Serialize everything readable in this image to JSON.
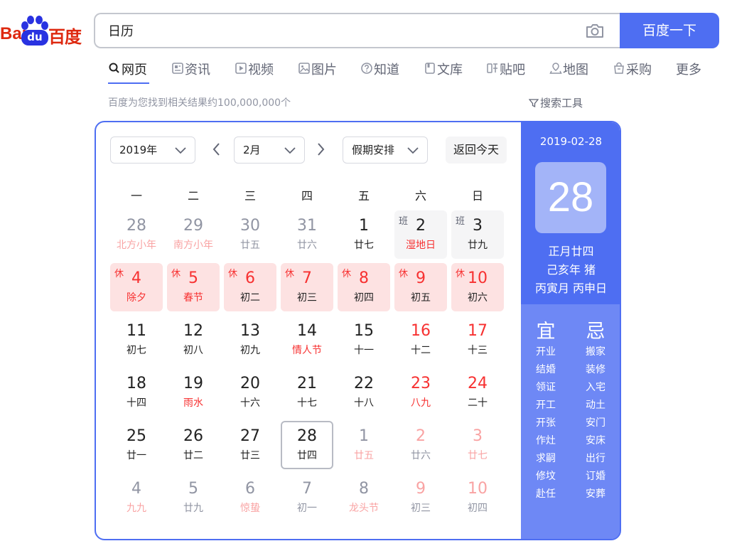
{
  "search": {
    "query": "日历",
    "button_label": "百度一下"
  },
  "logo": {
    "lead": "Bai",
    "du": "du",
    "cn": "百度"
  },
  "tabs": [
    {
      "label": "网页",
      "icon": "search-icon"
    },
    {
      "label": "资讯",
      "icon": "news-icon"
    },
    {
      "label": "视频",
      "icon": "video-icon"
    },
    {
      "label": "图片",
      "icon": "image-icon"
    },
    {
      "label": "知道",
      "icon": "question-icon"
    },
    {
      "label": "文库",
      "icon": "document-icon"
    },
    {
      "label": "贴吧",
      "icon": "tieba-icon"
    },
    {
      "label": "地图",
      "icon": "map-icon"
    },
    {
      "label": "采购",
      "icon": "shopping-icon"
    },
    {
      "label": "更多",
      "icon": ""
    }
  ],
  "results": {
    "count_text": "百度为您找到相关结果约100,000,000个",
    "tools_label": "搜索工具"
  },
  "calendar": {
    "year_select": "2019年",
    "month_select": "2月",
    "holiday_select": "假期安排",
    "today_button": "返回今天",
    "weekdays": [
      "一",
      "二",
      "三",
      "四",
      "五",
      "六",
      "日"
    ],
    "days": [
      {
        "n": "28",
        "s": "北方小年",
        "nc": "gray",
        "sc": "lred"
      },
      {
        "n": "29",
        "s": "南方小年",
        "nc": "gray",
        "sc": "lred"
      },
      {
        "n": "30",
        "s": "廿五",
        "nc": "gray",
        "sc": "gray"
      },
      {
        "n": "31",
        "s": "廿六",
        "nc": "gray",
        "sc": "gray"
      },
      {
        "n": "1",
        "s": "廿七",
        "nc": "black",
        "sc": "black"
      },
      {
        "n": "2",
        "s": "湿地日",
        "nc": "black",
        "sc": "red",
        "tag": "班",
        "bg": "work"
      },
      {
        "n": "3",
        "s": "廿九",
        "nc": "black",
        "sc": "black",
        "tag": "班",
        "bg": "work"
      },
      {
        "n": "4",
        "s": "除夕",
        "nc": "red",
        "sc": "red",
        "tag": "休",
        "bg": "rest"
      },
      {
        "n": "5",
        "s": "春节",
        "nc": "red",
        "sc": "red",
        "tag": "休",
        "bg": "rest"
      },
      {
        "n": "6",
        "s": "初二",
        "nc": "red",
        "sc": "black",
        "tag": "休",
        "bg": "rest"
      },
      {
        "n": "7",
        "s": "初三",
        "nc": "red",
        "sc": "black",
        "tag": "休",
        "bg": "rest"
      },
      {
        "n": "8",
        "s": "初四",
        "nc": "red",
        "sc": "black",
        "tag": "休",
        "bg": "rest"
      },
      {
        "n": "9",
        "s": "初五",
        "nc": "red",
        "sc": "black",
        "tag": "休",
        "bg": "rest"
      },
      {
        "n": "10",
        "s": "初六",
        "nc": "red",
        "sc": "black",
        "tag": "休",
        "bg": "rest"
      },
      {
        "n": "11",
        "s": "初七",
        "nc": "black",
        "sc": "black"
      },
      {
        "n": "12",
        "s": "初八",
        "nc": "black",
        "sc": "black"
      },
      {
        "n": "13",
        "s": "初九",
        "nc": "black",
        "sc": "black"
      },
      {
        "n": "14",
        "s": "情人节",
        "nc": "black",
        "sc": "red"
      },
      {
        "n": "15",
        "s": "十一",
        "nc": "black",
        "sc": "black"
      },
      {
        "n": "16",
        "s": "十二",
        "nc": "red",
        "sc": "black"
      },
      {
        "n": "17",
        "s": "十三",
        "nc": "red",
        "sc": "black"
      },
      {
        "n": "18",
        "s": "十四",
        "nc": "black",
        "sc": "black"
      },
      {
        "n": "19",
        "s": "雨水",
        "nc": "black",
        "sc": "red"
      },
      {
        "n": "20",
        "s": "十六",
        "nc": "black",
        "sc": "black"
      },
      {
        "n": "21",
        "s": "十七",
        "nc": "black",
        "sc": "black"
      },
      {
        "n": "22",
        "s": "十八",
        "nc": "black",
        "sc": "black"
      },
      {
        "n": "23",
        "s": "八九",
        "nc": "red",
        "sc": "red"
      },
      {
        "n": "24",
        "s": "二十",
        "nc": "red",
        "sc": "black"
      },
      {
        "n": "25",
        "s": "廿一",
        "nc": "black",
        "sc": "black"
      },
      {
        "n": "26",
        "s": "廿二",
        "nc": "black",
        "sc": "black"
      },
      {
        "n": "27",
        "s": "廿三",
        "nc": "black",
        "sc": "black"
      },
      {
        "n": "28",
        "s": "廿四",
        "nc": "black",
        "sc": "black",
        "selected": true
      },
      {
        "n": "1",
        "s": "廿五",
        "nc": "gray",
        "sc": "lred"
      },
      {
        "n": "2",
        "s": "廿六",
        "nc": "lred",
        "sc": "gray"
      },
      {
        "n": "3",
        "s": "廿七",
        "nc": "lred",
        "sc": "lred"
      },
      {
        "n": "4",
        "s": "九九",
        "nc": "gray",
        "sc": "lred"
      },
      {
        "n": "5",
        "s": "廿九",
        "nc": "gray",
        "sc": "gray"
      },
      {
        "n": "6",
        "s": "惊蛰",
        "nc": "gray",
        "sc": "lred"
      },
      {
        "n": "7",
        "s": "初一",
        "nc": "gray",
        "sc": "gray"
      },
      {
        "n": "8",
        "s": "龙头节",
        "nc": "gray",
        "sc": "lred"
      },
      {
        "n": "9",
        "s": "初三",
        "nc": "lred",
        "sc": "gray"
      },
      {
        "n": "10",
        "s": "初四",
        "nc": "lred",
        "sc": "gray"
      }
    ]
  },
  "detail": {
    "date": "2019-02-28",
    "day": "28",
    "lunar": "正月廿四",
    "year_gz": "己亥年 猪",
    "month_day_gz": "丙寅月 丙申日",
    "yi_title": "宜",
    "ji_title": "忌",
    "yi": [
      "开业",
      "结婚",
      "领证",
      "开工",
      "开张",
      "作灶",
      "求嗣",
      "修坟",
      "赴任"
    ],
    "ji": [
      "搬家",
      "装修",
      "入宅",
      "动土",
      "安门",
      "安床",
      "出行",
      "订婚",
      "安葬"
    ]
  },
  "colors": {
    "accent": "#4e6ef2",
    "holiday_red": "#f73131",
    "rest_bg": "#fde2e2"
  }
}
